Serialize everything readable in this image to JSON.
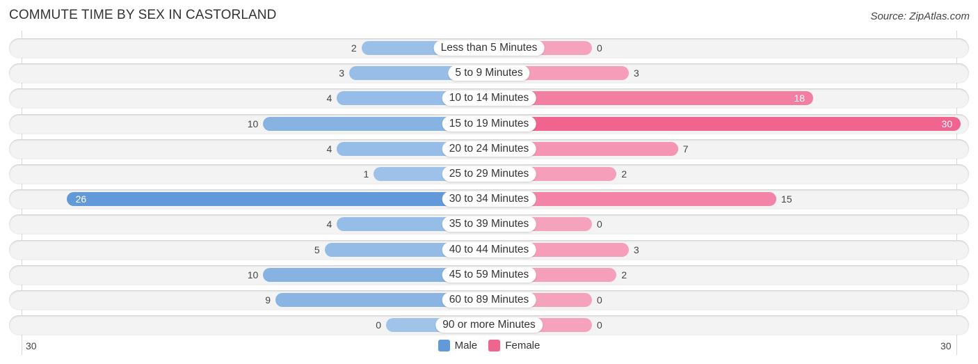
{
  "header": {
    "title": "COMMUTE TIME BY SEX IN CASTORLAND",
    "source": "Source: ZipAtlas.com"
  },
  "colors": {
    "male_light": "#9fc3e9",
    "male_strong": "#6199d9",
    "female_light": "#f5a3bd",
    "female_strong": "#f06590",
    "row_bg": "#f3f3f3"
  },
  "chart_data": {
    "type": "bar",
    "orientation": "horizontal-diverging",
    "title": "COMMUTE TIME BY SEX IN CASTORLAND",
    "categories": [
      "Less than 5 Minutes",
      "5 to 9 Minutes",
      "10 to 14 Minutes",
      "15 to 19 Minutes",
      "20 to 24 Minutes",
      "25 to 29 Minutes",
      "30 to 34 Minutes",
      "35 to 39 Minutes",
      "40 to 44 Minutes",
      "45 to 59 Minutes",
      "60 to 89 Minutes",
      "90 or more Minutes"
    ],
    "series": [
      {
        "name": "Male",
        "side": "left",
        "values": [
          2,
          3,
          4,
          10,
          4,
          1,
          26,
          4,
          5,
          10,
          9,
          0
        ]
      },
      {
        "name": "Female",
        "side": "right",
        "values": [
          0,
          3,
          18,
          30,
          7,
          2,
          15,
          0,
          3,
          2,
          0,
          0
        ]
      }
    ],
    "axis": {
      "left_max_label": "30",
      "right_max_label": "30",
      "max": 30
    },
    "legend": {
      "position": "bottom-center",
      "entries": [
        "Male",
        "Female"
      ]
    },
    "grid": false
  }
}
